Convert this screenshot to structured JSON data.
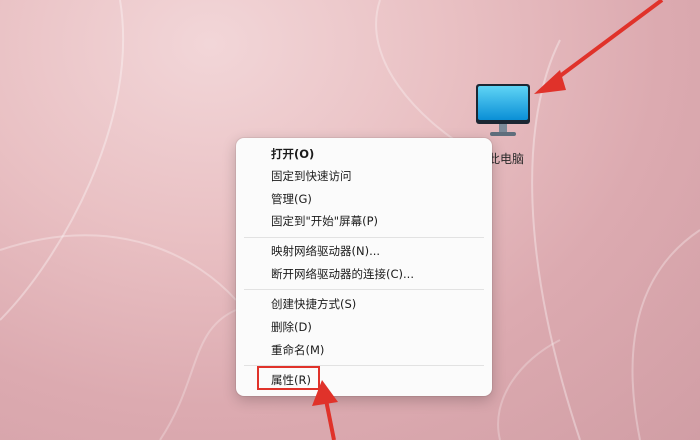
{
  "desktop": {
    "icon": {
      "label": "此电脑",
      "icon_name": "monitor-icon"
    }
  },
  "context_menu": {
    "items": [
      {
        "label": "打开(O)",
        "bold": true
      },
      {
        "label": "固定到快速访问"
      },
      {
        "label": "管理(G)"
      },
      {
        "label": "固定到\"开始\"屏幕(P)"
      },
      {
        "label": "映射网络驱动器(N)..."
      },
      {
        "label": "断开网络驱动器的连接(C)..."
      },
      {
        "label": "创建快捷方式(S)"
      },
      {
        "label": "删除(D)"
      },
      {
        "label": "重命名(M)"
      },
      {
        "label": "属性(R)"
      }
    ]
  },
  "annotations": {
    "arrow_color": "#e0322a",
    "highlight_color": "#e0322a"
  }
}
